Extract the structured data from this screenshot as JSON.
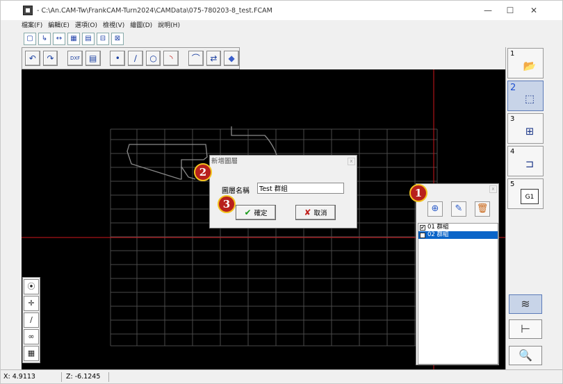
{
  "window": {
    "title": "- C:\\An.CAM-Tw\\FrankCAM-Turn2024\\CAMData\\075-780203-8_test.FCAM",
    "minimize": "—",
    "maximize": "☐",
    "close": "✕"
  },
  "menu": [
    "檔案(F)",
    "編輯(E)",
    "選項(O)",
    "檢視(V)",
    "繪圖(D)",
    "說明(H)"
  ],
  "toolbar_top": [
    "▢",
    "↳",
    "↔",
    "▦",
    "▤",
    "⊟",
    "⊠"
  ],
  "toolbar_draw": {
    "undo": "↶",
    "redo": "↷",
    "dxf": "DXF",
    "table": "▤",
    "point": "•",
    "line": "∕",
    "circle": "○",
    "arc": "◝",
    "fillet": "⌒",
    "trim": "⇄",
    "eraser": "◆"
  },
  "steps": [
    {
      "num": "1",
      "icon": "📂"
    },
    {
      "num": "2",
      "icon": "⬚"
    },
    {
      "num": "3",
      "icon": "⊞"
    },
    {
      "num": "4",
      "icon": "⊐"
    },
    {
      "num": "5",
      "icon": "G1"
    }
  ],
  "side_buttons": {
    "layers": "≋",
    "dimension": "⊢",
    "zoom": "🔍"
  },
  "left_tools": [
    "⦿",
    "✛",
    "∕",
    "∞",
    "▦"
  ],
  "status": {
    "x": "X: 4.9113",
    "z": "Z: -6.1245"
  },
  "dialog": {
    "title": "新增圖層",
    "close": "x",
    "label": "圖層名稱",
    "value": "Test 群組",
    "ok_icon": "✔",
    "ok": "確定",
    "cancel_icon": "✘",
    "cancel": "取消"
  },
  "layer_panel": {
    "close": "x",
    "add_icon": "⊕",
    "edit_icon": "✎",
    "delete_icon": "🗑",
    "items": [
      {
        "check": "✔",
        "label": "01 群組"
      },
      {
        "check": "",
        "label": "02 群組"
      }
    ]
  },
  "badges": [
    "1",
    "2",
    "3"
  ],
  "colors": {
    "canvas": "#000000",
    "grid": "#4a4a4a",
    "axis": "#d0161c",
    "selection": "#0a64c8",
    "badge": "#b8201c"
  }
}
